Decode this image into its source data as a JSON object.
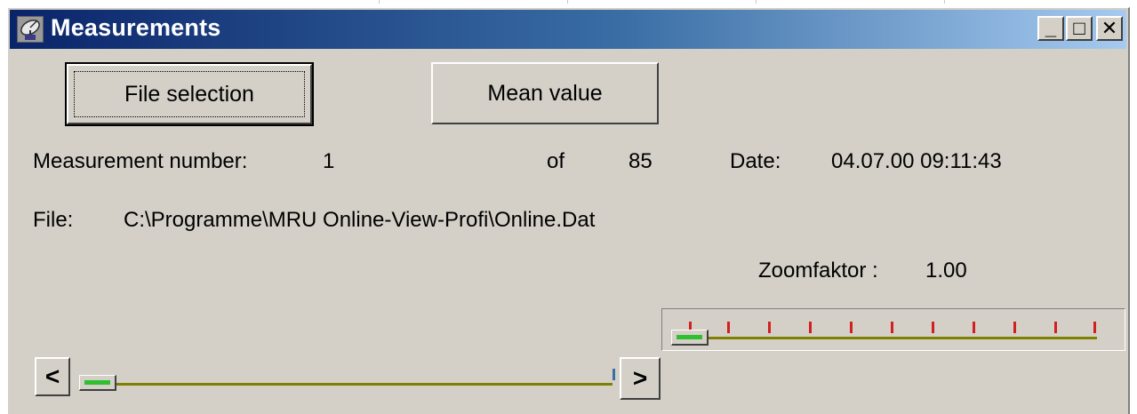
{
  "window": {
    "title": "Measurements",
    "icon": "satellite-dish-icon",
    "controls": {
      "minimize": "_",
      "maximize": "□",
      "close": "✕"
    }
  },
  "buttons": {
    "file_selection": "File selection",
    "mean_value": "Mean value"
  },
  "measurement": {
    "label": "Measurement number:",
    "number": "1",
    "of_label": "of",
    "total": "85",
    "date_label": "Date:",
    "date_value": "04.07.00 09:11:43"
  },
  "file": {
    "label": "File:",
    "path": "C:\\Programme\\MRU Online-View-Profi\\Online.Dat"
  },
  "zoom": {
    "label": "Zoomfaktor :",
    "value": "1.00",
    "slider_level": 0
  },
  "navigation": {
    "prev_label": "<",
    "next_label": ">",
    "slider_level": 0
  },
  "colors": {
    "window_face": "#d4d0c8",
    "title_gradient_start": "#0a246a",
    "title_gradient_end": "#a6caf0",
    "slider_track": "#808000",
    "slider_thumb_fill": "#2fbf2f",
    "tick_marks": "#d21f1f"
  }
}
